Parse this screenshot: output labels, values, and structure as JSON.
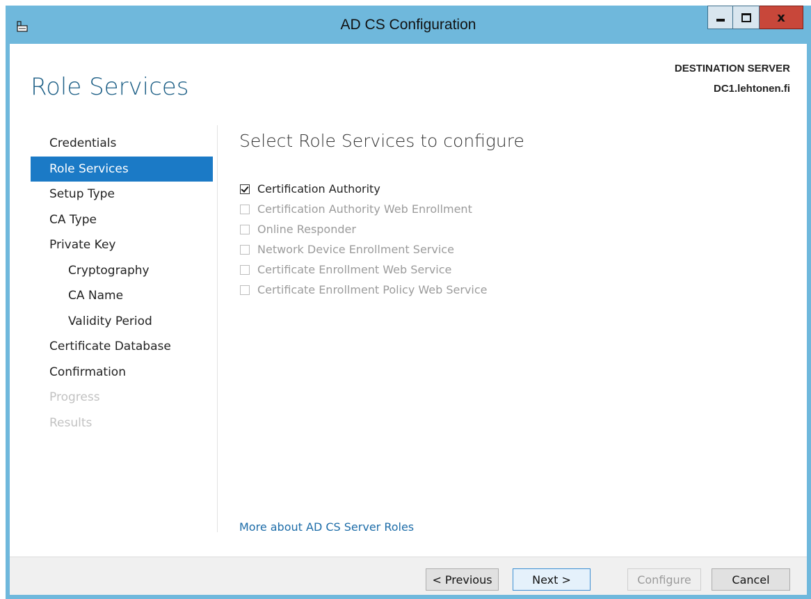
{
  "window": {
    "title": "AD CS Configuration",
    "controls": [
      "minimize",
      "maximize",
      "close"
    ]
  },
  "header": {
    "page_title": "Role Services",
    "destination_label": "DESTINATION SERVER",
    "destination_server": "DC1.lehtonen.fi"
  },
  "nav": {
    "items": [
      {
        "label": "Credentials",
        "state": "normal",
        "level": 0
      },
      {
        "label": "Role Services",
        "state": "active",
        "level": 0
      },
      {
        "label": "Setup Type",
        "state": "normal",
        "level": 0
      },
      {
        "label": "CA Type",
        "state": "normal",
        "level": 0
      },
      {
        "label": "Private Key",
        "state": "normal",
        "level": 0
      },
      {
        "label": "Cryptography",
        "state": "normal",
        "level": 1
      },
      {
        "label": "CA Name",
        "state": "normal",
        "level": 1
      },
      {
        "label": "Validity Period",
        "state": "normal",
        "level": 1
      },
      {
        "label": "Certificate Database",
        "state": "normal",
        "level": 0
      },
      {
        "label": "Confirmation",
        "state": "normal",
        "level": 0
      },
      {
        "label": "Progress",
        "state": "disabled",
        "level": 0
      },
      {
        "label": "Results",
        "state": "disabled",
        "level": 0
      }
    ]
  },
  "main": {
    "section_title": "Select Role Services to configure",
    "services": [
      {
        "label": "Certification Authority",
        "checked": true,
        "enabled": true
      },
      {
        "label": "Certification Authority Web Enrollment",
        "checked": false,
        "enabled": false
      },
      {
        "label": "Online Responder",
        "checked": false,
        "enabled": false
      },
      {
        "label": "Network Device Enrollment Service",
        "checked": false,
        "enabled": false
      },
      {
        "label": "Certificate Enrollment Web Service",
        "checked": false,
        "enabled": false
      },
      {
        "label": "Certificate Enrollment Policy Web Service",
        "checked": false,
        "enabled": false
      }
    ],
    "more_link": "More about AD CS Server Roles"
  },
  "footer": {
    "previous_label": "< Previous",
    "next_label": "Next >",
    "configure_label": "Configure",
    "cancel_label": "Cancel"
  },
  "colors": {
    "titlebar": "#6fb8dc",
    "accent": "#1b7ac6",
    "heading": "#1d5f86",
    "link": "#1c6ca8",
    "close_button": "#c8473a"
  }
}
